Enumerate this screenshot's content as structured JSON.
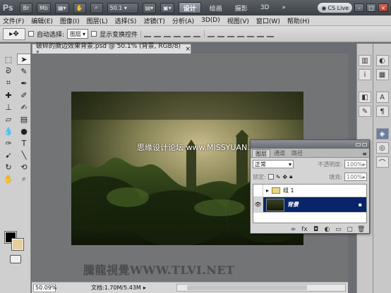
{
  "app": {
    "logo": "Ps",
    "bridge_label": "Br",
    "minibridge_label": "Mb",
    "zoom_readout": "50.1",
    "workspaces": [
      "设计",
      "绘画",
      "摄影",
      "3D"
    ],
    "more_label": "»",
    "cs_live": "CS Live",
    "min_btn": "–",
    "max_btn": "□",
    "close_btn": "×"
  },
  "menu": [
    "文件(F)",
    "编辑(E)",
    "图像(I)",
    "图层(L)",
    "选择(S)",
    "滤镜(T)",
    "分析(A)",
    "3D(D)",
    "视图(V)",
    "窗口(W)",
    "帮助(H)"
  ],
  "options_bar": {
    "tool_icon": "▸✥",
    "auto_select_label": "自动选择:",
    "auto_select_target": "图层",
    "show_transform_label": "显示变换控件"
  },
  "document": {
    "tab_title": "破碎的撕边效果背景.psd @ 50.1% (背景, RGB/8) *",
    "tab_close": "×",
    "watermark_top": "思缘设计论坛 www.MISSYUAN.COM",
    "watermark_bottom": "騰龍視覺WWW.TLVI.NET"
  },
  "status": {
    "zoom": "50.09%",
    "doc_info": "文档:1.70M/5.43M",
    "arrow": "▸"
  },
  "layers_panel": {
    "tabs": [
      "图层",
      "通道",
      "路径"
    ],
    "menu_icon": "≡",
    "blend_mode": "正常",
    "opacity_label": "不透明度:",
    "opacity_value": "100%",
    "lock_label": "锁定:",
    "fill_label": "填充:",
    "fill_value": "100%",
    "layers": [
      {
        "name": "组 1",
        "type": "group",
        "visible": false
      },
      {
        "name": "背景",
        "type": "pixel",
        "visible": true,
        "selected": true,
        "locked": true
      }
    ]
  },
  "dock": {
    "narrow_icons": [
      "histogram-icon",
      "info-icon",
      "navigator-icon",
      "tool-presets-icon"
    ],
    "wide_icons": [
      "color-icon",
      "swatches-icon",
      "character-icon",
      "paragraph-icon",
      "layers-icon",
      "channels-icon",
      "paths-icon"
    ]
  },
  "colors": {
    "foreground": "#000000",
    "background": "#e6cf9b",
    "selection": "#0a246a",
    "workspace": "#737476"
  }
}
